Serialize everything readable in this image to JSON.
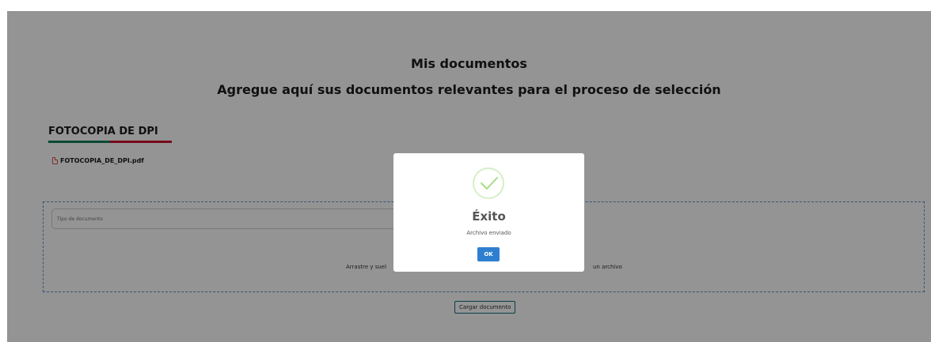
{
  "page": {
    "title": "Mis documentos",
    "subtitle": "Agregue aquí sus documentos relevantes para el proceso de selección"
  },
  "section": {
    "title": "FOTOCOPIA DE DPI",
    "file_name": "FOTOCOPIA_DE_DPI.pdf",
    "file_icon": "pdf-file-icon"
  },
  "upload": {
    "doc_type_placeholder": "Tipo de documento",
    "drop_text_left": "Arrastre y suel",
    "drop_text_right": "un archivo",
    "button_label": "Cargar documento"
  },
  "modal": {
    "icon": "success-check-icon",
    "title": "Éxito",
    "message": "Archivo enviado",
    "ok_label": "OK"
  },
  "colors": {
    "accent_green": "#0e7c5a",
    "accent_red": "#c8102e",
    "ok_button": "#2f7fd0",
    "dropzone_border": "#5b8fc9"
  }
}
